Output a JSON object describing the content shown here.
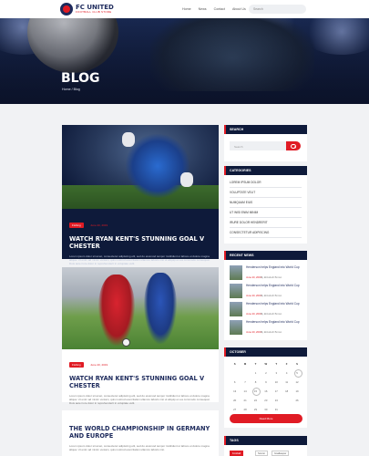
{
  "header": {
    "brand": "FC UNITED",
    "brand_sub": "FOOTBALL CLUB STORE",
    "nav": [
      "Home",
      "News",
      "Contact",
      "About Us"
    ],
    "search_placeholder": "Search"
  },
  "hero": {
    "title": "BLOG",
    "breadcrumb": "Home / Blog"
  },
  "posts": [
    {
      "badge": "Fishing",
      "date": "June 20, 2019",
      "title": "WATCH RYAN KENT'S STUNNING GOAL V CHESTER",
      "excerpt": "Lorem ipsum dolor sit amet, consectetur adipiscing elit, sed do eiusmod tempor incididunt ut labore et dolore magna aliqua. Ut enim ad minim veniam, quis nostrud exercitation ullamco laboris nisi ut aliquip ex ea commodo consequat. Duis aute irure dolor in reprehenderit in voluptate velit."
    },
    {
      "badge": "Fishing",
      "date": "June 20, 2019",
      "title": "WATCH RYAN KENT'S STUNNING GOAL V CHESTER",
      "excerpt": "Lorem ipsum dolor sit amet, consectetur adipiscing elit, sed do eiusmod tempor incididunt ut labore et dolore magna aliqua. Ut enim ad minim veniam, quis nostrud exercitation ullamco laboris nisi ut aliquip ex ea commodo consequat. Duis aute irure dolor in reprehenderit in voluptate velit."
    },
    {
      "title": "THE WORLD CHAMPIONSHIP IN GERMANY AND EUROPE",
      "excerpt": "Lorem ipsum dolor sit amet, consectetur adipiscing elit, sed do eiusmod tempor incididunt ut labore et dolore magna aliqua. Ut enim ad minim veniam, quis nostrud exercitation ullamco laboris nisi."
    }
  ],
  "sidebar": {
    "search": {
      "title": "SEARCH",
      "placeholder": "Search"
    },
    "categories": {
      "title": "CATEGORIES",
      "items": [
        "LOREM IPSUM DOLOR",
        "VOLUPTATE VELIT",
        "NUMQUAM EIUS",
        "UT WISI ENIM MINIM",
        "IRURE DOLOR HENDRERIT",
        "CONSECTETUR ADIPISCING"
      ]
    },
    "news": {
      "title": "RECENT NEWS",
      "items": [
        {
          "title": "Henderson helps England into World Cup",
          "date": "June 20, 2019",
          "by": "By Elizabeth Brown"
        },
        {
          "title": "Henderson helps England into World Cup",
          "date": "June 20, 2019",
          "by": "By Elizabeth Brown"
        },
        {
          "title": "Henderson helps England into World Cup",
          "date": "June 20, 2019",
          "by": "By Elizabeth Brown"
        },
        {
          "title": "Henderson helps England into World Cup",
          "date": "June 20, 2019",
          "by": "By Elizabeth Brown"
        }
      ]
    },
    "calendar": {
      "title": "OCTOBER",
      "dow": [
        "S",
        "M",
        "T",
        "W",
        "T",
        "F",
        "S"
      ],
      "weeks": [
        [
          "",
          "",
          "1",
          "2",
          "3",
          "4",
          "5"
        ],
        [
          "6",
          "7",
          "8",
          "9",
          "10",
          "11",
          "12"
        ],
        [
          "13",
          "14",
          "15",
          "16",
          "17",
          "18",
          "19"
        ],
        [
          "20",
          "21",
          "22",
          "23",
          "24",
          "25",
          "26"
        ],
        [
          "27",
          "28",
          "29",
          "30",
          "31",
          "",
          ""
        ]
      ],
      "button": "Read More"
    },
    "tags": {
      "title": "TAGS",
      "items": [
        "Football",
        "Soccer",
        "Goalkeeper"
      ]
    }
  },
  "colors": {
    "accent": "#e01b24",
    "navy": "#0e1a3a",
    "brand": "#1d2a5c"
  }
}
